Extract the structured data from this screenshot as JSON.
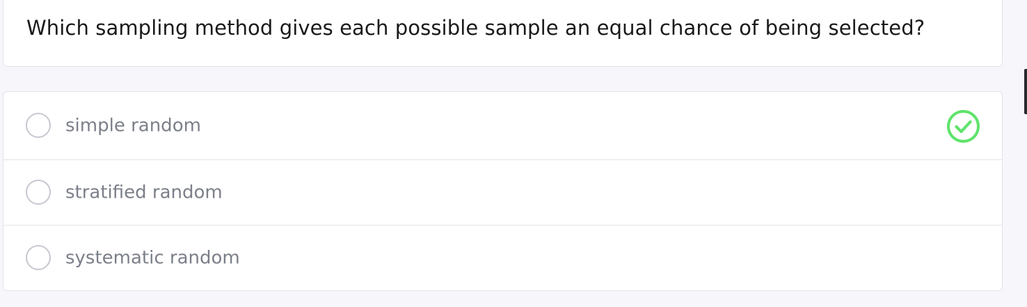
{
  "question": {
    "text": "Which sampling method gives each possible sample an equal chance of being selected?"
  },
  "options": [
    {
      "label": "simple random",
      "correct": true
    },
    {
      "label": "stratified random",
      "correct": false
    },
    {
      "label": "systematic random",
      "correct": false
    }
  ],
  "colors": {
    "correct_check": "#5fe36c",
    "option_text": "#7b7f89",
    "question_text": "#1a1a1a",
    "background": "#f7f7fb"
  },
  "icons": {
    "correct": "check-circle-icon",
    "radio": "radio-circle"
  }
}
